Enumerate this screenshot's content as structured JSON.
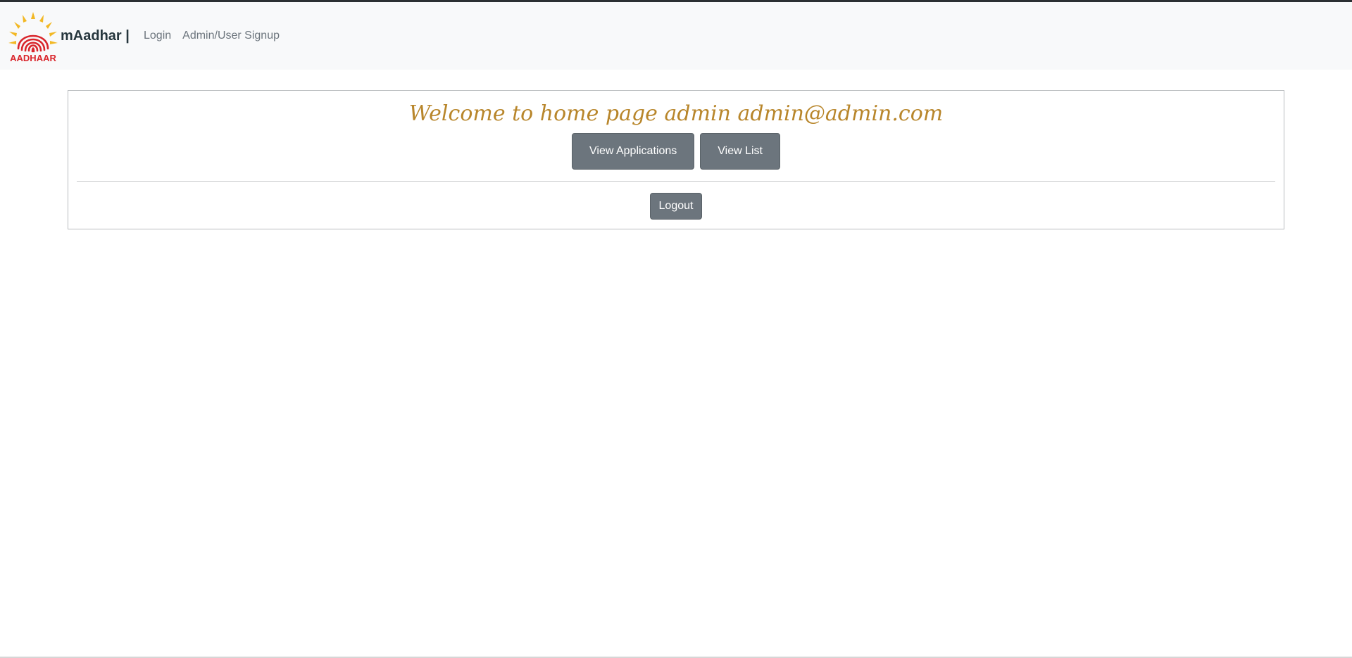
{
  "navbar": {
    "logo_text": "AADHAAR",
    "brand": "mAadhar |",
    "links": [
      {
        "label": "Login"
      },
      {
        "label": "Admin/User Signup"
      }
    ]
  },
  "main": {
    "welcome": "Welcome to home page admin admin@admin.com",
    "buttons": [
      {
        "label": "View Applications"
      },
      {
        "label": "View List"
      }
    ],
    "logout_label": "Logout"
  },
  "colors": {
    "navbar_bg": "#f8f9fa",
    "button_bg": "#6c757d",
    "welcome_text": "#b8862b",
    "brand_text": "#26363d"
  }
}
